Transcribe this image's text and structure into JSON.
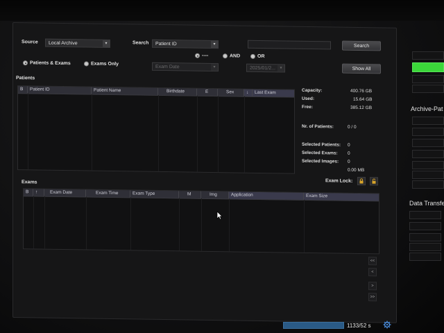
{
  "filter": {
    "source_label": "Source",
    "source_value": "Local Archive",
    "search_label": "Search",
    "search_field_value": "Patient ID",
    "search_text_value": "",
    "search_button": "Search",
    "show_all_button": "Show All",
    "radio_patients_exams": "Patients & Exams",
    "radio_exams_only": "Exams Only",
    "radio_none": "----",
    "radio_and": "AND",
    "radio_or": "OR",
    "exam_date_value": "Exam Date",
    "date_value": "2025/01/2..."
  },
  "patients": {
    "title": "Patients",
    "columns": [
      "B",
      "Patient ID",
      "Patient Name",
      "Birthdate",
      "E",
      "Sex",
      "↓",
      "Last Exam"
    ]
  },
  "stats": {
    "capacity_label": "Capacity:",
    "capacity_value": "400.76 GB",
    "used_label": "Used:",
    "used_value": "15.64 GB",
    "free_label": "Free:",
    "free_value": "385.12 GB",
    "nr_patients_label": "Nr. of Patients:",
    "nr_patients_value": "0 / 0",
    "selected_patients_label": "Selected Patients:",
    "selected_patients_value": "0",
    "selected_exams_label": "Selected Exams:",
    "selected_exams_value": "0",
    "selected_images_label": "Selected Images:",
    "selected_images_value": "0",
    "selected_size_value": "0.00 MB"
  },
  "exams": {
    "title": "Exams",
    "lock_label": "Exam Lock:",
    "columns": [
      "B",
      "↑",
      "Exam Date",
      "Exam Time",
      "Exam Type",
      "M",
      "Img",
      "Application",
      "Exam Size"
    ]
  },
  "nav": {
    "first": "<<",
    "prev": "<",
    "next": ">",
    "last": ">>"
  },
  "right_panel": {
    "archive_heading": "Archive-Pat",
    "transfer_heading": "Data Transfe"
  },
  "status": {
    "progress_text": "1133/52 s",
    "progress_fraction": 1.0,
    "accent_green": "#3bd73a",
    "progress_color": "#2a5a86"
  }
}
